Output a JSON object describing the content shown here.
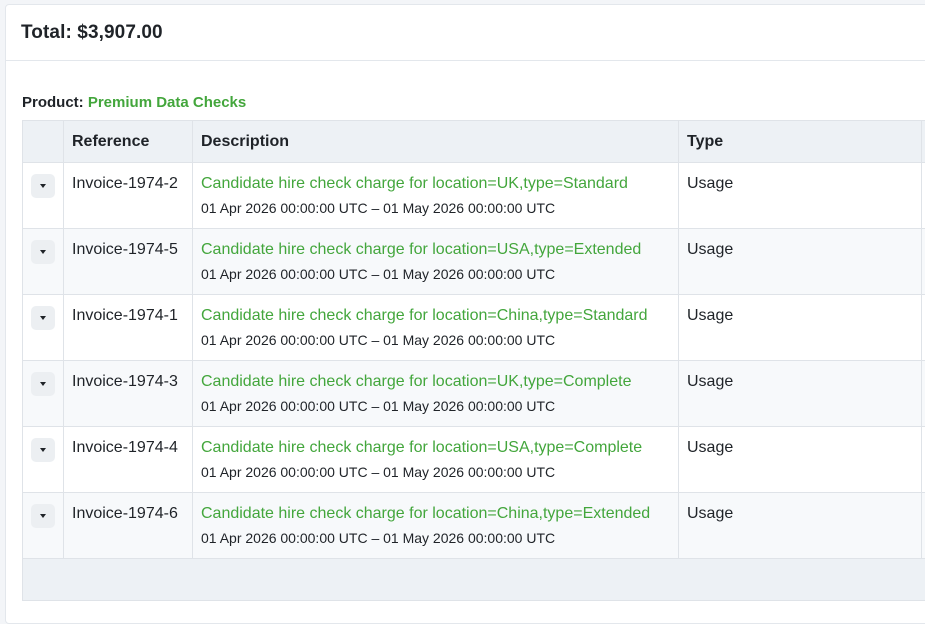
{
  "summary": {
    "total_text": "Total: $3,907.00"
  },
  "product": {
    "label": "Product:",
    "name": "Premium Data Checks"
  },
  "table": {
    "headers": {
      "reference": "Reference",
      "description": "Description",
      "type": "Type"
    },
    "rows": [
      {
        "reference": "Invoice-1974-2",
        "description": "Candidate hire check charge for location=UK,type=Standard",
        "period": "01 Apr 2026 00:00:00 UTC – 01 May 2026 00:00:00 UTC",
        "type": "Usage"
      },
      {
        "reference": "Invoice-1974-5",
        "description": "Candidate hire check charge for location=USA,type=Extended",
        "period": "01 Apr 2026 00:00:00 UTC – 01 May 2026 00:00:00 UTC",
        "type": "Usage"
      },
      {
        "reference": "Invoice-1974-1",
        "description": "Candidate hire check charge for location=China,type=Standard",
        "period": "01 Apr 2026 00:00:00 UTC – 01 May 2026 00:00:00 UTC",
        "type": "Usage"
      },
      {
        "reference": "Invoice-1974-3",
        "description": "Candidate hire check charge for location=UK,type=Complete",
        "period": "01 Apr 2026 00:00:00 UTC – 01 May 2026 00:00:00 UTC",
        "type": "Usage"
      },
      {
        "reference": "Invoice-1974-4",
        "description": "Candidate hire check charge for location=USA,type=Complete",
        "period": "01 Apr 2026 00:00:00 UTC – 01 May 2026 00:00:00 UTC",
        "type": "Usage"
      },
      {
        "reference": "Invoice-1974-6",
        "description": "Candidate hire check charge for location=China,type=Extended",
        "period": "01 Apr 2026 00:00:00 UTC – 01 May 2026 00:00:00 UTC",
        "type": "Usage"
      }
    ]
  },
  "icons": {
    "expand": "caret-down-icon"
  },
  "colors": {
    "accent_green": "#43a63c",
    "header_bg": "#edf1f5",
    "row_alt_bg": "#f7f9fb"
  }
}
